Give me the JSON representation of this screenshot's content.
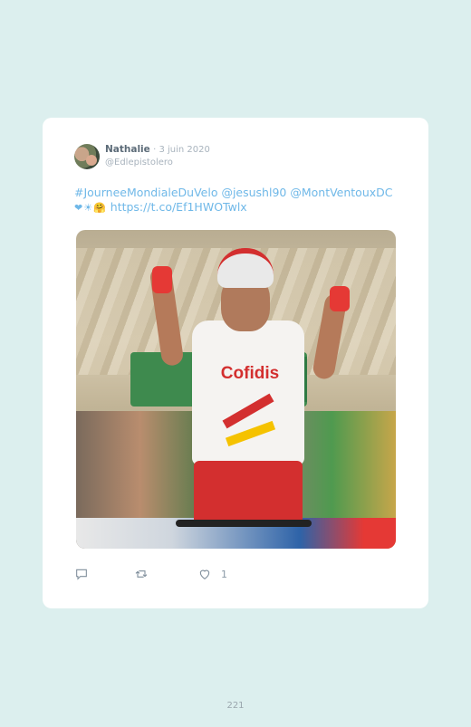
{
  "tweet": {
    "author_name": "Nathalie",
    "date": "· 3 juin 2020",
    "handle": "@Edlepistolero",
    "text_line1": "#JourneeMondialeDuVelo @jesushl90 @MontVentouxDC",
    "emojis": "❤☀🤗",
    "link": "https://t.co/Ef1HWOTwlx",
    "photo_jersey_logo": "Cofidis",
    "like_count": "1"
  },
  "icons": {
    "reply": "reply-icon",
    "retweet": "retweet-icon",
    "like": "heart-icon"
  },
  "colors": {
    "background": "#dcefee",
    "link": "#6fb8e8"
  },
  "page": {
    "number": "221"
  }
}
